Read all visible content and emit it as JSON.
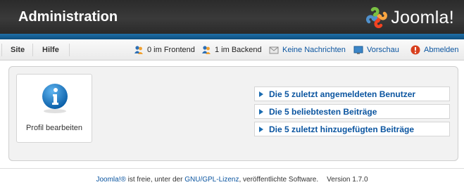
{
  "header": {
    "title": "Administration",
    "logo_text": "Joomla!"
  },
  "toolbar": {
    "menu": [
      "Site",
      "Hilfe"
    ],
    "frontend": "0 im Frontend",
    "backend": "1 im Backend",
    "messages": "Keine Nachrichten",
    "preview": "Vorschau",
    "logout": "Abmelden"
  },
  "quickicon": {
    "label": "Profil bearbeiten",
    "icon": "info-icon"
  },
  "modules": [
    "Die 5 zuletzt angemeldeten Benutzer",
    "Die 5 beliebtesten Beiträge",
    "Die 5 zuletzt hinzugefügten Beiträge"
  ],
  "footer": {
    "joomla_link": "Joomla!®",
    "text_1": " ist freie, unter der ",
    "license_link": "GNU/GPL-Lizenz",
    "text_2": ", veröffentlichte Software.",
    "version": "Version 1.7.0"
  },
  "colors": {
    "link": "#0b55a0",
    "header_bg": "#2e2e2e",
    "stripe": "#1f6fa8"
  }
}
